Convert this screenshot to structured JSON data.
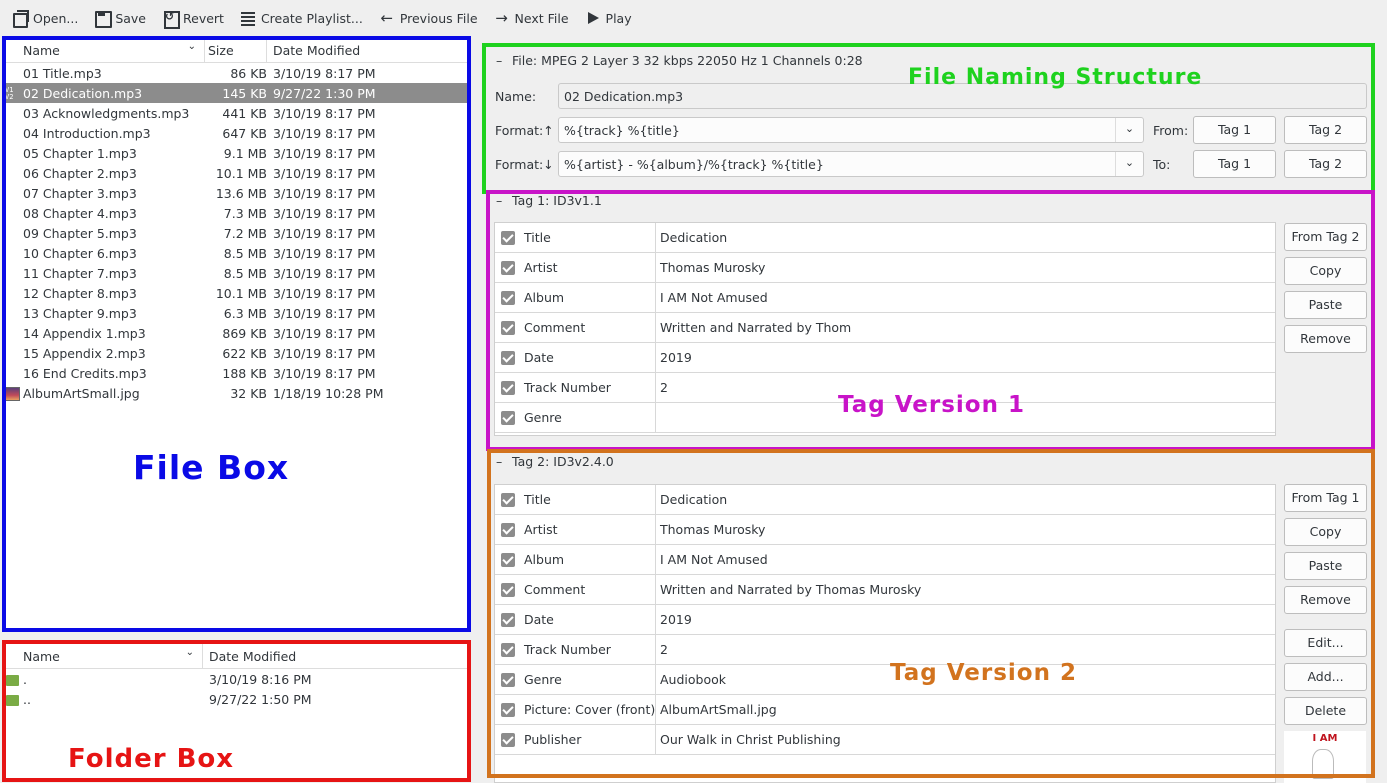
{
  "toolbar": {
    "open": "Open...",
    "save": "Save",
    "revert": "Revert",
    "create_playlist": "Create Playlist...",
    "previous_file": "Previous File",
    "next_file": "Next File",
    "play": "Play"
  },
  "file_list": {
    "headers": {
      "name": "Name",
      "size": "Size",
      "date": "Date Modified"
    },
    "rows": [
      {
        "name": "01 Title.mp3",
        "size": "86 KB",
        "date": "3/10/19 8:17 PM"
      },
      {
        "name": "02 Dedication.mp3",
        "size": "145 KB",
        "date": "9/27/22 1:30 PM"
      },
      {
        "name": "03 Acknowledgments.mp3",
        "size": "441 KB",
        "date": "3/10/19 8:17 PM"
      },
      {
        "name": "04 Introduction.mp3",
        "size": "647 KB",
        "date": "3/10/19 8:17 PM"
      },
      {
        "name": "05 Chapter 1.mp3",
        "size": "9.1 MB",
        "date": "3/10/19 8:17 PM"
      },
      {
        "name": "06 Chapter 2.mp3",
        "size": "10.1 MB",
        "date": "3/10/19 8:17 PM"
      },
      {
        "name": "07 Chapter 3.mp3",
        "size": "13.6 MB",
        "date": "3/10/19 8:17 PM"
      },
      {
        "name": "08 Chapter 4.mp3",
        "size": "7.3 MB",
        "date": "3/10/19 8:17 PM"
      },
      {
        "name": "09 Chapter 5.mp3",
        "size": "7.2 MB",
        "date": "3/10/19 8:17 PM"
      },
      {
        "name": "10 Chapter 6.mp3",
        "size": "8.5 MB",
        "date": "3/10/19 8:17 PM"
      },
      {
        "name": "11 Chapter 7.mp3",
        "size": "8.5 MB",
        "date": "3/10/19 8:17 PM"
      },
      {
        "name": "12 Chapter 8.mp3",
        "size": "10.1 MB",
        "date": "3/10/19 8:17 PM"
      },
      {
        "name": "13 Chapter 9.mp3",
        "size": "6.3 MB",
        "date": "3/10/19 8:17 PM"
      },
      {
        "name": "14 Appendix 1.mp3",
        "size": "869 KB",
        "date": "3/10/19 8:17 PM"
      },
      {
        "name": "15 Appendix 2.mp3",
        "size": "622 KB",
        "date": "3/10/19 8:17 PM"
      },
      {
        "name": "16 End Credits.mp3",
        "size": "188 KB",
        "date": "3/10/19 8:17 PM"
      },
      {
        "name": "AlbumArtSmall.jpg",
        "size": "32 KB",
        "date": "1/18/19 10:28 PM"
      }
    ]
  },
  "folder_list": {
    "headers": {
      "name": "Name",
      "date": "Date Modified"
    },
    "rows": [
      {
        "name": ".",
        "date": "3/10/19 8:16 PM"
      },
      {
        "name": "..",
        "date": "9/27/22 1:50 PM"
      }
    ]
  },
  "file_section": {
    "title": "File: MPEG 2 Layer 3 32 kbps 22050 Hz 1 Channels 0:28",
    "name_label": "Name:",
    "name_value": "02 Dedication.mp3",
    "format_up_label": "Format:↑",
    "format_up_value": "%{track} %{title}",
    "format_down_label": "Format:↓",
    "format_down_value": "%{artist} - %{album}/%{track} %{title}",
    "from_label": "From:",
    "to_label": "To:",
    "tag1": "Tag 1",
    "tag2": "Tag 2"
  },
  "tag1": {
    "title": "Tag 1: ID3v1.1",
    "rows": [
      {
        "field": "Title",
        "value": "Dedication"
      },
      {
        "field": "Artist",
        "value": "Thomas Murosky"
      },
      {
        "field": "Album",
        "value": "I AM Not Amused"
      },
      {
        "field": "Comment",
        "value": "Written and Narrated by Thom"
      },
      {
        "field": "Date",
        "value": "2019"
      },
      {
        "field": "Track Number",
        "value": "2"
      },
      {
        "field": "Genre",
        "value": ""
      }
    ],
    "buttons": {
      "from_tag": "From Tag 2",
      "copy": "Copy",
      "paste": "Paste",
      "remove": "Remove"
    }
  },
  "tag2": {
    "title": "Tag 2: ID3v2.4.0",
    "rows": [
      {
        "field": "Title",
        "value": "Dedication"
      },
      {
        "field": "Artist",
        "value": "Thomas Murosky"
      },
      {
        "field": "Album",
        "value": "I AM Not Amused"
      },
      {
        "field": "Comment",
        "value": "Written and Narrated by Thomas Murosky"
      },
      {
        "field": "Date",
        "value": "2019"
      },
      {
        "field": "Track Number",
        "value": "2"
      },
      {
        "field": "Genre",
        "value": "Audiobook"
      },
      {
        "field": "Picture: Cover (front)",
        "value": "AlbumArtSmall.jpg"
      },
      {
        "field": "Publisher",
        "value": "Our Walk in Christ Publishing"
      }
    ],
    "buttons": {
      "from_tag": "From Tag 1",
      "copy": "Copy",
      "paste": "Paste",
      "remove": "Remove",
      "edit": "Edit...",
      "add": "Add...",
      "delete": "Delete"
    }
  },
  "cover_text": "I AM",
  "annotations": {
    "file_box": {
      "text": "File Box",
      "color": "#0a0ae6"
    },
    "folder_box": {
      "text": "Folder Box",
      "color": "#e61414"
    },
    "file_naming": {
      "text": "File Naming Structure",
      "color": "#1ed21e"
    },
    "tag_v1": {
      "text": "Tag Version 1",
      "color": "#c814c8"
    },
    "tag_v2": {
      "text": "Tag Version 2",
      "color": "#d2731e"
    }
  }
}
